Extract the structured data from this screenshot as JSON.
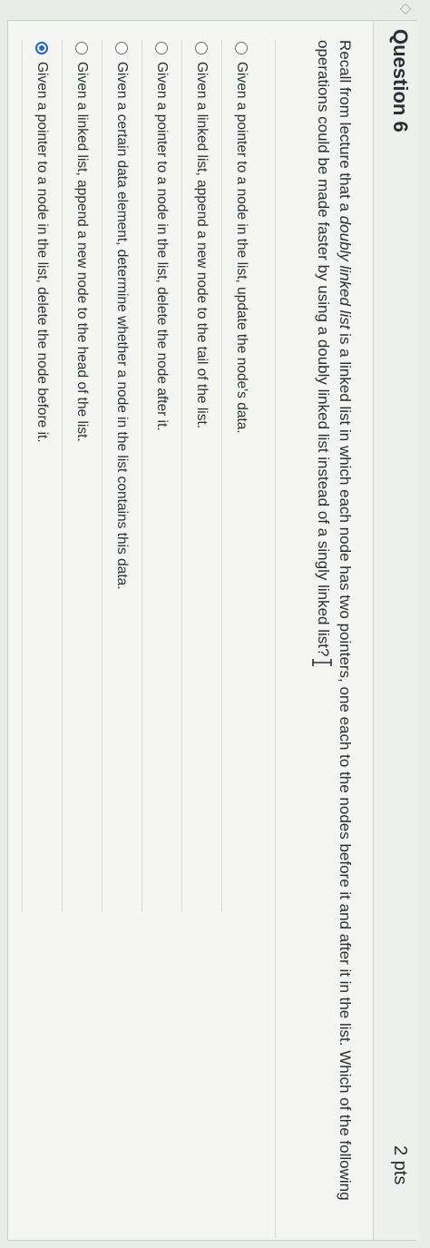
{
  "question": {
    "title": "Question 6",
    "points": "2 pts",
    "prompt_part1": "Recall from lecture that a ",
    "prompt_emphasis": "doubly linked list",
    "prompt_part2": " is a linked list in which each node has two pointers, one each to the nodes before it and after it in the list. Which of the following operations could be made faster by using a doubly linked list instead of a singly linked list?"
  },
  "answers": [
    {
      "label": "Given a pointer to a node in the list, update the node's data.",
      "selected": false
    },
    {
      "label": "Given a linked list, append a new node to the tail of the list.",
      "selected": false
    },
    {
      "label": "Given a pointer to a node in the list, delete the node after it.",
      "selected": false
    },
    {
      "label": "Given a certain data element, determine whether a node in the list contains this data.",
      "selected": false
    },
    {
      "label": "Given a linked list, append a new node to the head of the list.",
      "selected": false
    },
    {
      "label": "Given a pointer to a node in the list, delete the node before it.",
      "selected": true
    }
  ],
  "colors": {
    "selected_radio": "#1f66c9",
    "text": "#2b2f33",
    "card_background": "#f5f6f4"
  },
  "icons": {
    "text_cursor": "text-cursor-icon",
    "collapse_arrow": "chevron-icon"
  }
}
